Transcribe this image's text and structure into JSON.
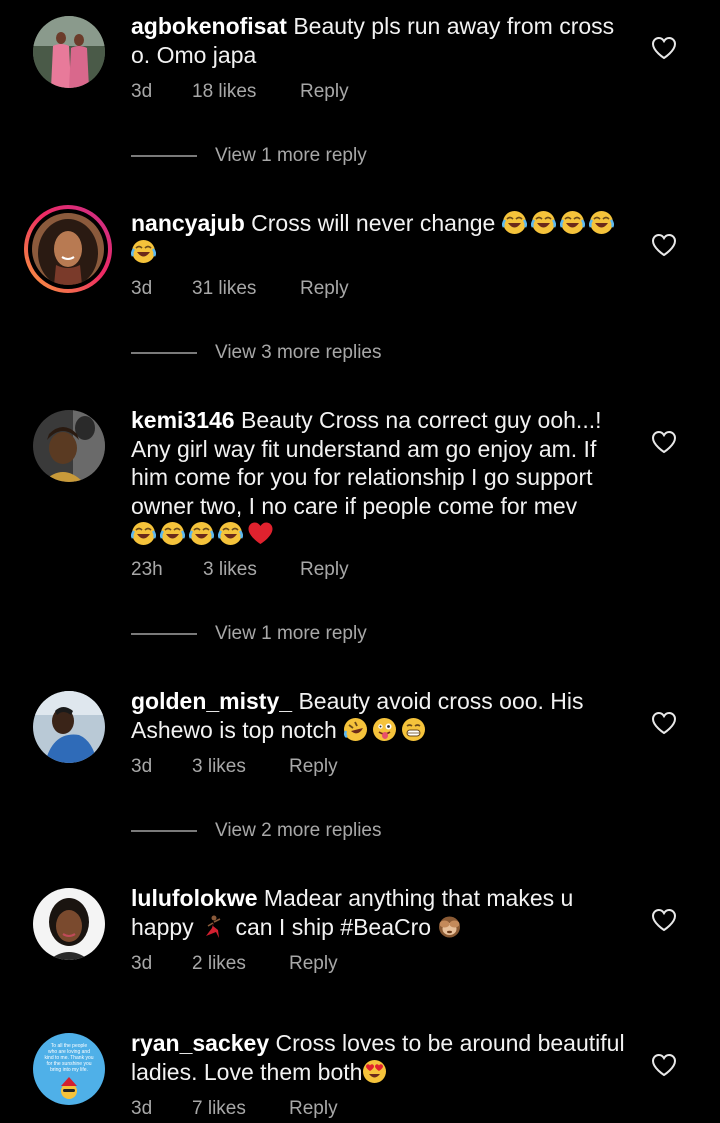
{
  "comments": [
    {
      "username": "agbokenofisat",
      "text": "Beauty pls run away from cross o. Omo japa",
      "time": "3d",
      "likes": "18 likes",
      "reply": "Reply",
      "view_replies": "View 1 more reply"
    },
    {
      "username": "nancyajub",
      "text": "Cross will never change",
      "time": "3d",
      "likes": "31 likes",
      "reply": "Reply",
      "view_replies": "View 3 more replies"
    },
    {
      "username": "kemi3146",
      "text": "Beauty Cross na correct guy ooh...! Any girl way fit understand am go enjoy am. If him come for you for relationship I go support owner two, I no care if people come for mev",
      "time": "23h",
      "likes": "3 likes",
      "reply": "Reply",
      "view_replies": "View 1 more reply"
    },
    {
      "username": "golden_misty_",
      "text": "Beauty avoid cross ooo. His Ashewo is top notch",
      "time": "3d",
      "likes": "3 likes",
      "reply": "Reply",
      "view_replies": "View 2 more replies"
    },
    {
      "username": "lulufolokwe",
      "text_before": "Madear anything that makes u happy",
      "text_after": "can I ship #BeaCro",
      "time": "3d",
      "likes": "2 likes",
      "reply": "Reply"
    },
    {
      "username": "ryan_sackey",
      "text": "Cross loves to be around beautiful ladies. Love them both",
      "time": "3d",
      "likes": "7 likes",
      "reply": "Reply",
      "avatar_text": "To all the people who are loving and kind to me. Thank you for the sunshine you bring into my life."
    }
  ],
  "colors": {
    "background": "#000000",
    "text": "#f2f2f2",
    "secondary": "#a8a8a8",
    "story_ring_start": "#f9a13c",
    "story_ring_end": "#c72f8c"
  },
  "icons": {
    "like": "heart-outline-icon",
    "laugh": "face-with-tears-of-joy-emoji",
    "heart": "red-heart-emoji"
  }
}
